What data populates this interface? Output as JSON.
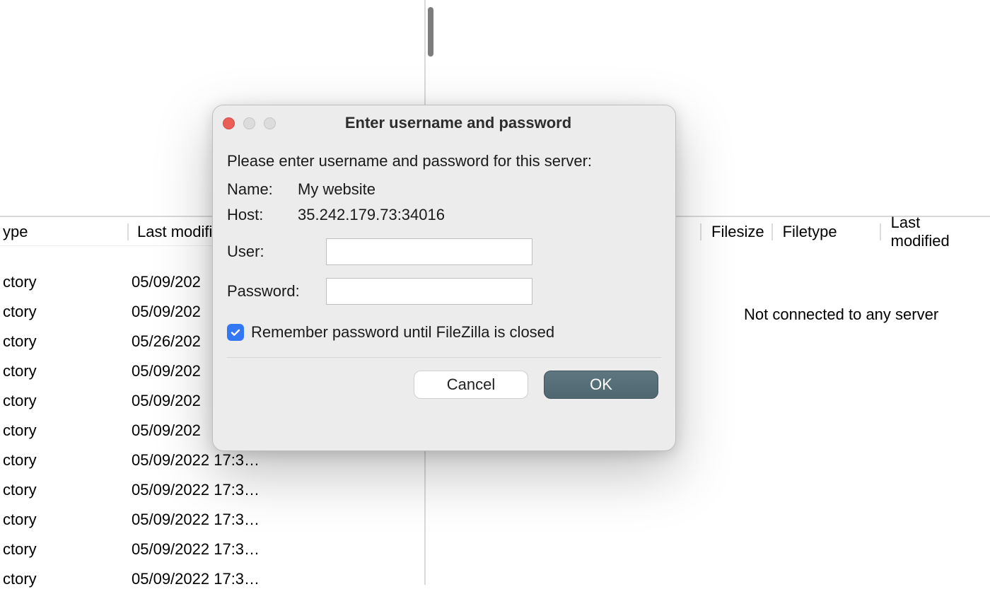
{
  "background": {
    "left_headers": {
      "ype": "ype",
      "last_modified": "Last modifi"
    },
    "right_headers": {
      "filesize": "Filesize",
      "filetype": "Filetype",
      "last_modified": "Last modified"
    },
    "left_rows": [
      {
        "type": "ctory",
        "modified": "05/09/202"
      },
      {
        "type": "ctory",
        "modified": "05/09/202"
      },
      {
        "type": "ctory",
        "modified": "05/26/202"
      },
      {
        "type": "ctory",
        "modified": "05/09/202"
      },
      {
        "type": "ctory",
        "modified": "05/09/202"
      },
      {
        "type": "ctory",
        "modified": "05/09/202"
      },
      {
        "type": "ctory",
        "modified": "05/09/2022 17:3…"
      },
      {
        "type": "ctory",
        "modified": "05/09/2022 17:3…"
      },
      {
        "type": "ctory",
        "modified": "05/09/2022 17:3…"
      },
      {
        "type": "ctory",
        "modified": "05/09/2022 17:3…"
      },
      {
        "type": "ctory",
        "modified": "05/09/2022 17:3…"
      }
    ],
    "right_message": "Not connected to any server"
  },
  "dialog": {
    "title": "Enter username and password",
    "prompt": "Please enter username and password for this server:",
    "name_label": "Name:",
    "name_value": "My website",
    "host_label": "Host:",
    "host_value": "35.242.179.73:34016",
    "user_label": "User:",
    "user_value": "",
    "password_label": "Password:",
    "password_value": "",
    "remember_label": "Remember password until FileZilla is closed",
    "remember_checked": true,
    "cancel_label": "Cancel",
    "ok_label": "OK"
  }
}
